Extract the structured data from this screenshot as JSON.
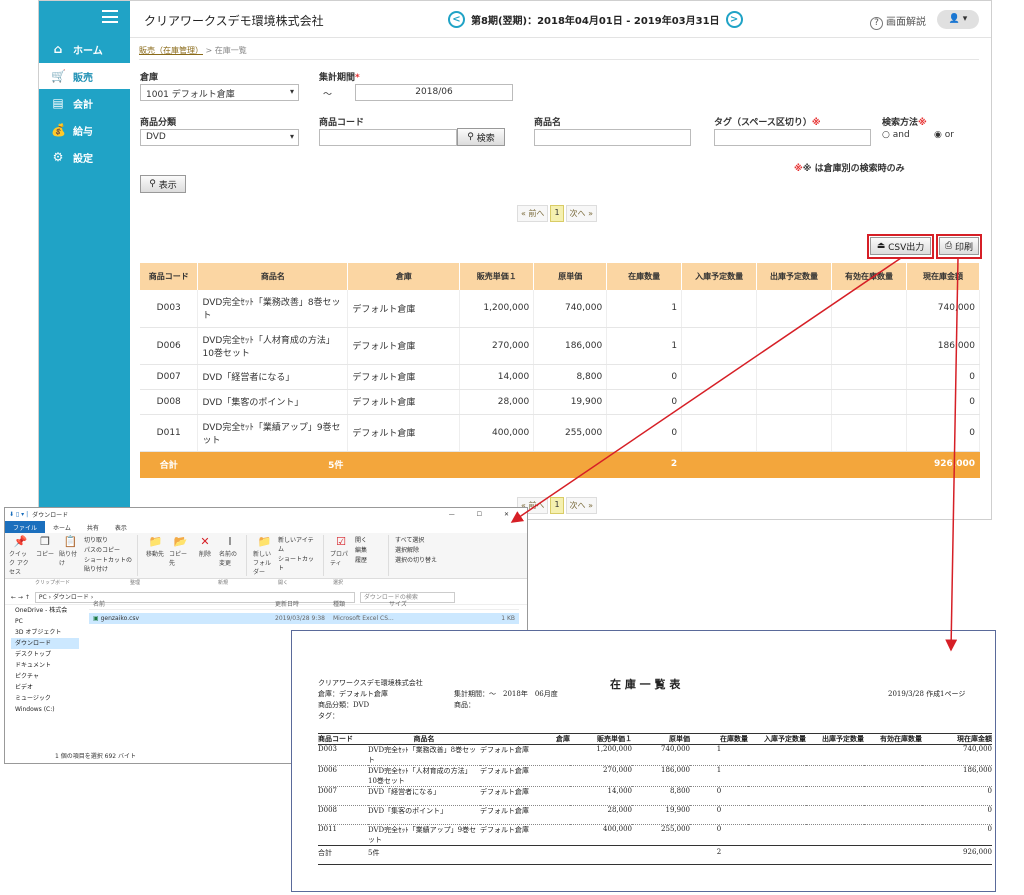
{
  "sidebar": {
    "items": [
      {
        "icon": "home-icon",
        "glyph": "⌂",
        "label": "ホーム"
      },
      {
        "icon": "cart-icon",
        "glyph": "🛒",
        "label": "販売"
      },
      {
        "icon": "calculator-icon",
        "glyph": "▤",
        "label": "会計"
      },
      {
        "icon": "money-bag-icon",
        "glyph": "💰",
        "label": "給与"
      },
      {
        "icon": "gear-icon",
        "glyph": "⚙",
        "label": "設定"
      }
    ]
  },
  "header": {
    "company": "クリアワークスデモ環境株式会社",
    "period": "第8期(翌期)：2018年04月01日 - 2019年03月31日",
    "help_label": "画面解説",
    "user_glyph": "👤 ▾"
  },
  "breadcrumb": {
    "parent": "販売（在庫管理）",
    "separator": ">",
    "current": "在庫一覧"
  },
  "form": {
    "warehouse_label": "倉庫",
    "warehouse_value": "1001 デフォルト倉庫",
    "period_label": "集計期間",
    "period_tilde": "〜",
    "period_value": "2018/06",
    "category_label": "商品分類",
    "category_value": "DVD",
    "code_label": "商品コード",
    "code_value": "",
    "search_button": "検索",
    "name_label": "商品名",
    "name_value": "",
    "tag_label": "タグ（スペース区切り）",
    "tag_value": "",
    "method_label": "検索方法",
    "method_and": "and",
    "method_or": "or",
    "note": "※ は倉庫別の検索時のみ",
    "show_button": "表示",
    "required_mark": "*",
    "note_mark": "※"
  },
  "pager": {
    "prev": "« 前へ",
    "current": "1",
    "next": "次へ »"
  },
  "actions": {
    "csv": "CSV出力",
    "print": "印刷"
  },
  "table": {
    "headers": [
      "商品コード",
      "商品名",
      "倉庫",
      "販売単価１",
      "原単価",
      "在庫数量",
      "入庫予定数量",
      "出庫予定数量",
      "有効在庫数量",
      "現在庫金額"
    ],
    "rows": [
      [
        "D003",
        "DVD完全ｾｯﾄ「業務改善」8巻セット",
        "デフォルト倉庫",
        "1,200,000",
        "740,000",
        "1",
        "",
        "",
        "",
        "740,000"
      ],
      [
        "D006",
        "DVD完全ｾｯﾄ「人材育成の方法」10巻セット",
        "デフォルト倉庫",
        "270,000",
        "186,000",
        "1",
        "",
        "",
        "",
        "186,000"
      ],
      [
        "D007",
        "DVD「経営者になる」",
        "デフォルト倉庫",
        "14,000",
        "8,800",
        "0",
        "",
        "",
        "",
        "0"
      ],
      [
        "D008",
        "DVD「集客のポイント」",
        "デフォルト倉庫",
        "28,000",
        "19,900",
        "0",
        "",
        "",
        "",
        "0"
      ],
      [
        "D011",
        "DVD完全ｾｯﾄ「業績アップ」9巻セット",
        "デフォルト倉庫",
        "400,000",
        "255,000",
        "0",
        "",
        "",
        "",
        "0"
      ]
    ],
    "total": {
      "label": "合計",
      "count": "5件",
      "qty": "2",
      "amount": "926,000"
    }
  },
  "explorer": {
    "title": "ダウンロード",
    "tabs": [
      "ファイル",
      "ホーム",
      "共有",
      "表示"
    ],
    "ribbon": [
      "クイック アクセス",
      "コピー",
      "貼り付け",
      "切り取り",
      "パスのコピー",
      "ショートカットの貼り付け",
      "移動先",
      "コピー先",
      "削除",
      "名前の変更",
      "新しいフォルダー",
      "新しいアイテム",
      "ショートカット",
      "プロパティ",
      "開く",
      "編集",
      "履歴",
      "すべて選択",
      "選択解除",
      "選択の切り替え"
    ],
    "groups": [
      "クリップボード",
      "整理",
      "新規",
      "開く",
      "選択"
    ],
    "path": "PC › ダウンロード ›",
    "search": "ダウンロードの検索",
    "nav": [
      "OneDrive - 株式会",
      "PC",
      "3D オブジェクト",
      "ダウンロード",
      "デスクトップ",
      "ドキュメント",
      "ピクチャ",
      "ビデオ",
      "ミュージック",
      "Windows (C:)"
    ],
    "cols": [
      "名前",
      "更新日時",
      "種類",
      "サイズ"
    ],
    "file": {
      "name": "genzaiko.csv",
      "date": "2019/03/28 9:38",
      "type": "Microsoft Excel CS...",
      "size": "1 KB"
    },
    "status": "1 個の項目を選択  692 バイト"
  },
  "report": {
    "company": "クリアワークスデモ環境株式会社",
    "title": "在 庫 一 覧 表",
    "warehouse": "倉庫：デフォルト倉庫",
    "category": "商品分類：DVD",
    "tag": "タグ：",
    "period": "集計期間：〜　2018年　06月度",
    "name": "商品：",
    "created": "2019/3/28 作成",
    "page": "1ページ",
    "headers": [
      "商品コード",
      "商品名",
      "倉庫",
      "販売単価１",
      "原単価",
      "在庫数量",
      "入庫予定数量",
      "出庫予定数量",
      "有効在庫数量",
      "現在庫金額"
    ],
    "rows": [
      [
        "D003",
        "DVD完全ｾｯﾄ「業務改善」8巻セット",
        "デフォルト倉庫",
        "1,200,000",
        "740,000",
        "1",
        "740,000"
      ],
      [
        "D006",
        "DVD完全ｾｯﾄ「人材育成の方法」10巻セット",
        "デフォルト倉庫",
        "270,000",
        "186,000",
        "1",
        "186,000"
      ],
      [
        "D007",
        "DVD「経営者になる」",
        "デフォルト倉庫",
        "14,000",
        "8,800",
        "0",
        "0"
      ],
      [
        "D008",
        "DVD「集客のポイント」",
        "デフォルト倉庫",
        "28,000",
        "19,900",
        "0",
        "0"
      ],
      [
        "D011",
        "DVD完全ｾｯﾄ「業績アップ」9巻セット",
        "デフォルト倉庫",
        "400,000",
        "255,000",
        "0",
        "0"
      ]
    ],
    "total": {
      "label": "合計",
      "count": "5件",
      "qty": "2",
      "amount": "926,000"
    }
  },
  "colors": {
    "sidebar": "#20a3c6",
    "table_header": "#fbd6a3",
    "total_row": "#f3a63c",
    "highlight": "#d61f26"
  }
}
